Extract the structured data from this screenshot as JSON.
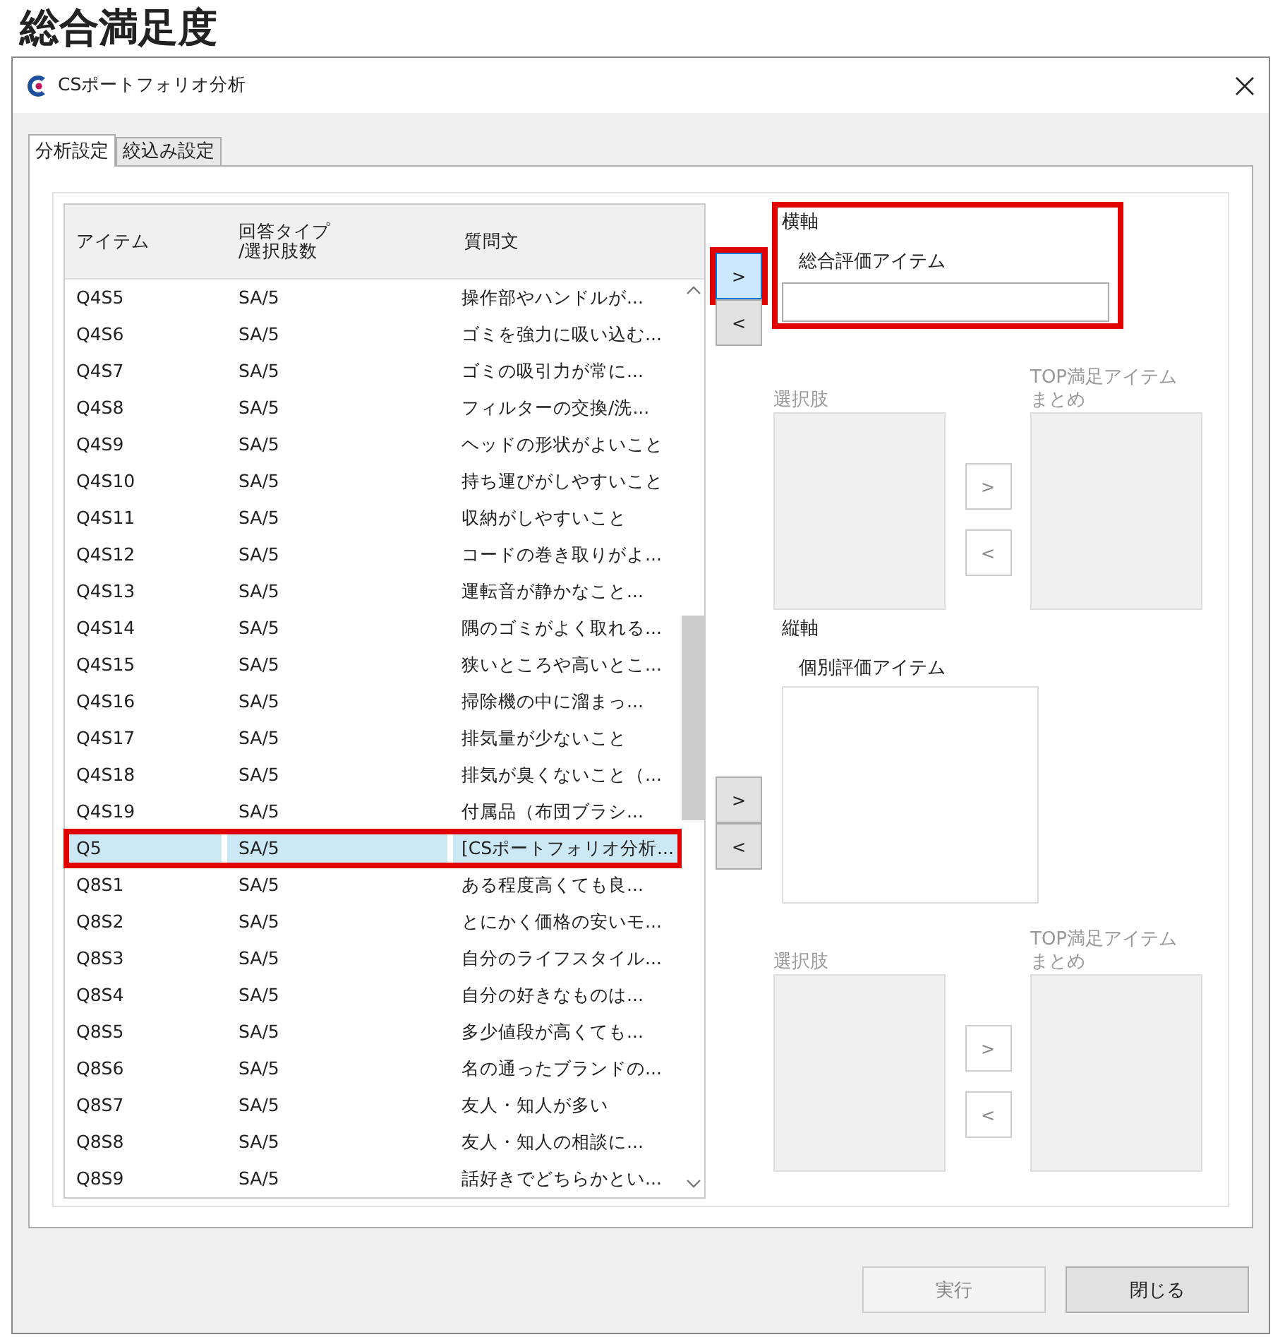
{
  "page_title": "総合満足度",
  "window": {
    "title": "CSポートフォリオ分析"
  },
  "tabs": [
    {
      "label": "分析設定",
      "selected": true
    },
    {
      "label": "絞込み設定",
      "selected": false
    }
  ],
  "item_list": {
    "columns": [
      "アイテム",
      "回答タイプ\n/選択肢数",
      "質問文"
    ],
    "rows": [
      {
        "cells": [
          "Q4S5",
          "SA/5",
          "操作部やハンドルが..."
        ],
        "selected": false,
        "highlighted": false
      },
      {
        "cells": [
          "Q4S6",
          "SA/5",
          "ゴミを強力に吸い込む..."
        ],
        "selected": false,
        "highlighted": false
      },
      {
        "cells": [
          "Q4S7",
          "SA/5",
          "ゴミの吸引力が常に..."
        ],
        "selected": false,
        "highlighted": false
      },
      {
        "cells": [
          "Q4S8",
          "SA/5",
          "フィルターの交換/洗..."
        ],
        "selected": false,
        "highlighted": false
      },
      {
        "cells": [
          "Q4S9",
          "SA/5",
          "ヘッドの形状がよいこと"
        ],
        "selected": false,
        "highlighted": false
      },
      {
        "cells": [
          "Q4S10",
          "SA/5",
          "持ち運びがしやすいこと"
        ],
        "selected": false,
        "highlighted": false
      },
      {
        "cells": [
          "Q4S11",
          "SA/5",
          "収納がしやすいこと"
        ],
        "selected": false,
        "highlighted": false
      },
      {
        "cells": [
          "Q4S12",
          "SA/5",
          "コードの巻き取りがよ..."
        ],
        "selected": false,
        "highlighted": false
      },
      {
        "cells": [
          "Q4S13",
          "SA/5",
          "運転音が静かなこと..."
        ],
        "selected": false,
        "highlighted": false
      },
      {
        "cells": [
          "Q4S14",
          "SA/5",
          "隅のゴミがよく取れる..."
        ],
        "selected": false,
        "highlighted": false
      },
      {
        "cells": [
          "Q4S15",
          "SA/5",
          "狭いところや高いとこ..."
        ],
        "selected": false,
        "highlighted": false
      },
      {
        "cells": [
          "Q4S16",
          "SA/5",
          "掃除機の中に溜まっ..."
        ],
        "selected": false,
        "highlighted": false
      },
      {
        "cells": [
          "Q4S17",
          "SA/5",
          "排気量が少ないこと"
        ],
        "selected": false,
        "highlighted": false
      },
      {
        "cells": [
          "Q4S18",
          "SA/5",
          "排気が臭くないこと（..."
        ],
        "selected": false,
        "highlighted": false
      },
      {
        "cells": [
          "Q4S19",
          "SA/5",
          "付属品（布団ブラシ..."
        ],
        "selected": false,
        "highlighted": false
      },
      {
        "cells": [
          "Q5",
          "SA/5",
          "[CSポートフォリオ分析..."
        ],
        "selected": true,
        "highlighted": true
      },
      {
        "cells": [
          "Q8S1",
          "SA/5",
          "ある程度高くても良..."
        ],
        "selected": false,
        "highlighted": false
      },
      {
        "cells": [
          "Q8S2",
          "SA/5",
          "とにかく価格の安いモ..."
        ],
        "selected": false,
        "highlighted": false
      },
      {
        "cells": [
          "Q8S3",
          "SA/5",
          "自分のライフスタイル..."
        ],
        "selected": false,
        "highlighted": false
      },
      {
        "cells": [
          "Q8S4",
          "SA/5",
          "自分の好きなものは..."
        ],
        "selected": false,
        "highlighted": false
      },
      {
        "cells": [
          "Q8S5",
          "SA/5",
          "多少値段が高くても..."
        ],
        "selected": false,
        "highlighted": false
      },
      {
        "cells": [
          "Q8S6",
          "SA/5",
          "名の通ったブランドの..."
        ],
        "selected": false,
        "highlighted": false
      },
      {
        "cells": [
          "Q8S7",
          "SA/5",
          "友人・知人が多い"
        ],
        "selected": false,
        "highlighted": false
      },
      {
        "cells": [
          "Q8S8",
          "SA/5",
          "友人・知人の相談に..."
        ],
        "selected": false,
        "highlighted": false
      },
      {
        "cells": [
          "Q8S9",
          "SA/5",
          "話好きでどちらかとい..."
        ],
        "selected": false,
        "highlighted": false
      }
    ]
  },
  "axes": [
    {
      "label": "横軸",
      "field_label": "総合評価アイテム",
      "kind": "field",
      "highlighted": true,
      "move_buttons": [
        {
          "label": ">",
          "focused": true,
          "highlighted": true
        },
        {
          "label": "<",
          "focused": false,
          "highlighted": false
        }
      ],
      "choices_label": "選択肢",
      "top_label": [
        "TOP満足アイテム",
        "まとめ"
      ],
      "disabled": true,
      "choice_buttons": [
        ">",
        "<"
      ]
    },
    {
      "label": "縦軸",
      "field_label": "個別評価アイテム",
      "kind": "list",
      "highlighted": false,
      "move_buttons": [
        {
          "label": ">",
          "focused": false,
          "highlighted": false
        },
        {
          "label": "<",
          "focused": false,
          "highlighted": false
        }
      ],
      "choices_label": "選択肢",
      "top_label": [
        "TOP満足アイテム",
        "まとめ"
      ],
      "disabled": true,
      "choice_buttons": [
        ">",
        "<"
      ]
    }
  ],
  "footer_buttons": [
    {
      "label": "実行",
      "disabled": true
    },
    {
      "label": "閉じる",
      "disabled": false
    }
  ]
}
